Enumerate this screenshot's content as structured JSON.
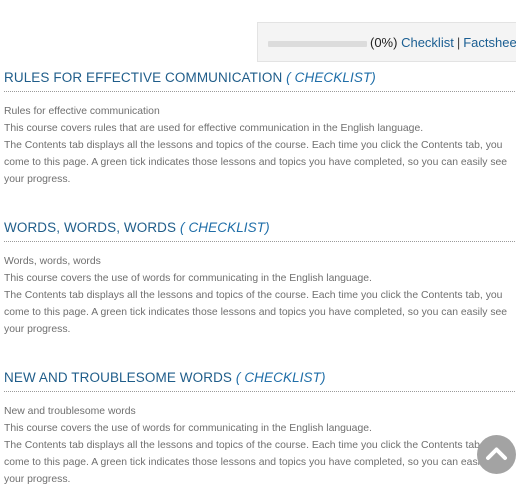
{
  "progress": {
    "percent_text": "(0%)",
    "percent_value": 0,
    "checklist_link": "Checklist",
    "separator": "|",
    "factsheet_link": "Factsheet"
  },
  "sections": [
    {
      "title": "RULES FOR EFFECTIVE COMMUNICATION",
      "checklist": "( CHECKLIST)",
      "line1": "Rules for effective communication",
      "line2": "This course covers rules that are used for effective communication in the English language.",
      "line3": "The Contents tab displays all the lessons and topics of the course. Each time you click the Contents tab, you come to this page. A green tick indicates those lessons and topics you have completed, so you can easily see your progress."
    },
    {
      "title": "WORDS, WORDS, WORDS",
      "checklist": "( CHECKLIST)",
      "line1": "Words, words, words",
      "line2": "This course covers the use of words for communicating in the English language.",
      "line3": "The Contents tab displays all the lessons and topics of the course. Each time you click the Contents tab, you come to this page. A green tick indicates those lessons and topics you have completed, so you can easily see your progress."
    },
    {
      "title": "NEW AND TROUBLESOME WORDS",
      "checklist": "( CHECKLIST)",
      "line1": "New and troublesome words",
      "line2": "This course covers the use of words for communicating in the English language.",
      "line3": "The Contents tab displays all the lessons and topics of the course. Each time you click the Contents tab, you come to this page. A green tick indicates those lessons and topics you have completed, so you can easily see your progress."
    }
  ],
  "scroll_top": {
    "icon": "chevron-up-icon"
  }
}
